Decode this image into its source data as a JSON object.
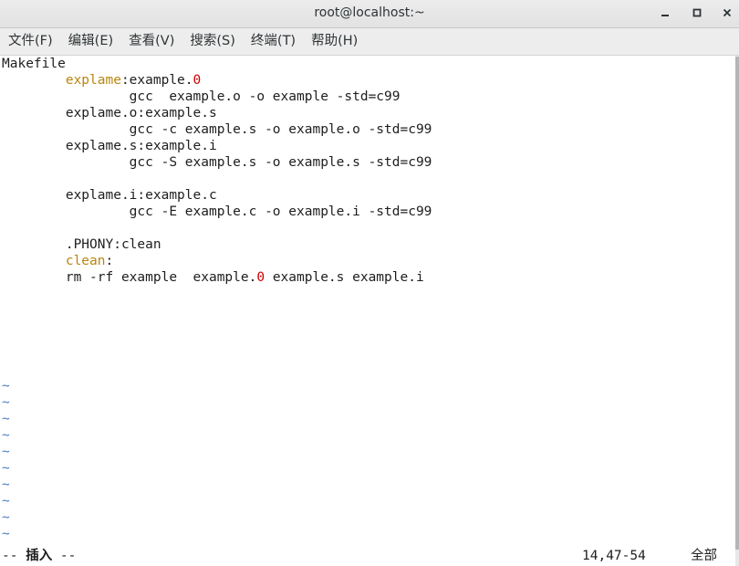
{
  "window": {
    "title": "root@localhost:~"
  },
  "menu": [
    {
      "label": "文件(F)"
    },
    {
      "label": "编辑(E)"
    },
    {
      "label": "查看(V)"
    },
    {
      "label": "搜索(S)"
    },
    {
      "label": "终端(T)"
    },
    {
      "label": "帮助(H)"
    }
  ],
  "editor": {
    "lines": [
      {
        "segments": [
          {
            "text": "Makefile",
            "cls": ""
          }
        ]
      },
      {
        "segments": [
          {
            "text": "        ",
            "cls": ""
          },
          {
            "text": "explame",
            "cls": "kw"
          },
          {
            "text": ":example.",
            "cls": ""
          },
          {
            "text": "0",
            "cls": "red"
          }
        ]
      },
      {
        "segments": [
          {
            "text": "                gcc  example.o -o example -std=c99",
            "cls": ""
          }
        ]
      },
      {
        "segments": [
          {
            "text": "        explame.o:example.s",
            "cls": ""
          }
        ]
      },
      {
        "segments": [
          {
            "text": "                gcc -c example.s -o example.o -std=c99",
            "cls": ""
          }
        ]
      },
      {
        "segments": [
          {
            "text": "        explame.s:example.i",
            "cls": ""
          }
        ]
      },
      {
        "segments": [
          {
            "text": "                gcc -S example.s -o example.s -std=c99",
            "cls": ""
          }
        ]
      },
      {
        "segments": [
          {
            "text": "",
            "cls": ""
          }
        ]
      },
      {
        "segments": [
          {
            "text": "        explame.i:example.c",
            "cls": ""
          }
        ]
      },
      {
        "segments": [
          {
            "text": "                gcc -E example.c -o example.i -std=c99",
            "cls": ""
          }
        ]
      },
      {
        "segments": [
          {
            "text": "",
            "cls": ""
          }
        ]
      },
      {
        "segments": [
          {
            "text": "        .PHONY:clean",
            "cls": ""
          }
        ]
      },
      {
        "segments": [
          {
            "text": "        ",
            "cls": ""
          },
          {
            "text": "clean",
            "cls": "kw"
          },
          {
            "text": ":",
            "cls": ""
          }
        ]
      },
      {
        "segments": [
          {
            "text": "        rm -rf example  example.",
            "cls": ""
          },
          {
            "text": "0",
            "cls": "red"
          },
          {
            "text": " example.s example.i",
            "cls": ""
          }
        ]
      }
    ],
    "tilde_char": "~",
    "tilde_count": 10
  },
  "status": {
    "mode_prefix": "-- ",
    "mode": "插入",
    "mode_suffix": " --",
    "position": "14,47-54",
    "percent": "全部"
  },
  "colors": {
    "keyword": "#b8860b",
    "error": "#cc0000",
    "tilde": "#4a7ec7"
  }
}
